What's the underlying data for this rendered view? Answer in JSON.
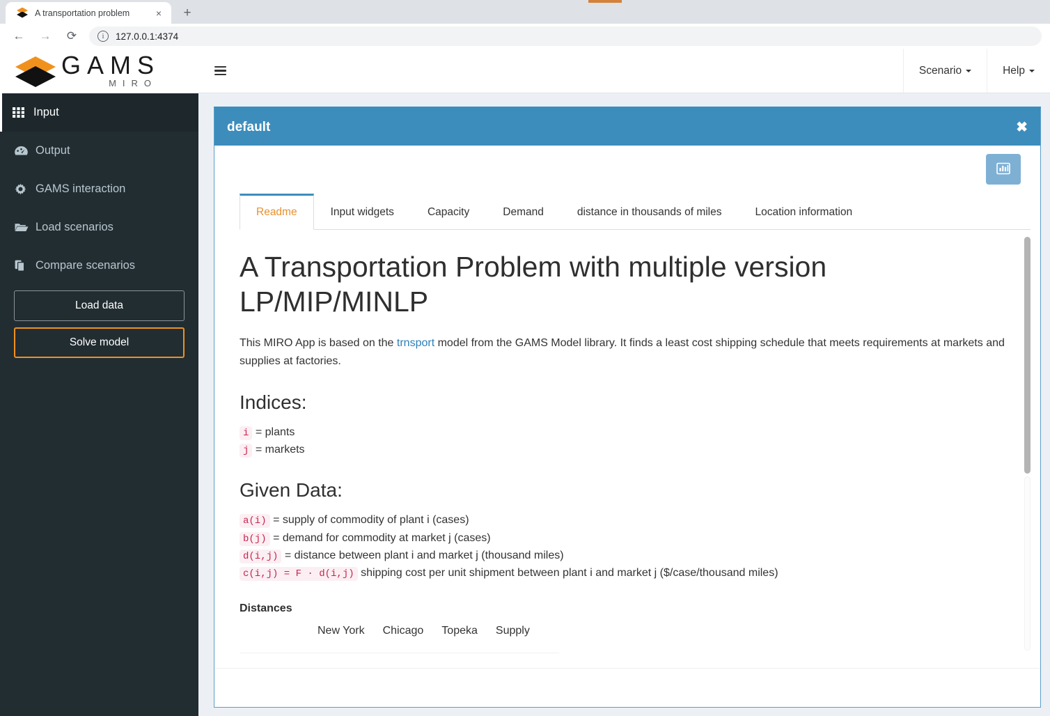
{
  "browser": {
    "tab_title": "A transportation problem",
    "tab_close_label": "×",
    "new_tab_label": "+",
    "back_label": "←",
    "forward_label": "→",
    "reload_label": "⟳",
    "site_info_label": "i",
    "url": "127.0.0.1:4374"
  },
  "brand": {
    "name": "GAMS",
    "sub": "MIRO",
    "orange": "#f0911e",
    "black": "#111111"
  },
  "sidebar": {
    "items": [
      {
        "label": "Input",
        "icon": "grid-icon",
        "active": true
      },
      {
        "label": "Output",
        "icon": "dashboard-icon",
        "active": false
      },
      {
        "label": "GAMS interaction",
        "icon": "gear-icon",
        "active": false
      },
      {
        "label": "Load scenarios",
        "icon": "folder-open-icon",
        "active": false
      },
      {
        "label": "Compare scenarios",
        "icon": "copy-icon",
        "active": false
      }
    ],
    "buttons": [
      {
        "label": "Load data",
        "style": "default"
      },
      {
        "label": "Solve model",
        "style": "accent"
      }
    ]
  },
  "topbar": {
    "menu_icon": "hamburger-icon",
    "scenario_label": "Scenario",
    "help_label": "Help"
  },
  "panel": {
    "title": "default",
    "close_label": "✖",
    "chart_button_icon": "bar-chart-icon",
    "accent_color": "#3c8dbc",
    "tabs": [
      {
        "label": "Readme",
        "active": true
      },
      {
        "label": "Input widgets",
        "active": false
      },
      {
        "label": "Capacity",
        "active": false
      },
      {
        "label": "Demand",
        "active": false
      },
      {
        "label": "distance in thousands of miles",
        "active": false
      },
      {
        "label": "Location information",
        "active": false
      }
    ]
  },
  "readme": {
    "title": "A Transportation Problem with multiple version LP/MIP/MINLP",
    "intro_before_link": "This MIRO App is based on the ",
    "intro_link": "trnsport",
    "intro_after_link": " model from the GAMS Model library. It finds a least cost shipping schedule that meets requirements at markets and supplies at factories.",
    "indices_heading": "Indices:",
    "indices": [
      {
        "code": "i",
        "text": "= plants"
      },
      {
        "code": "j",
        "text": "= markets"
      }
    ],
    "given_data_heading": "Given Data:",
    "given_data": [
      {
        "code": "a(i)",
        "text": "= supply of commodity of plant i (cases)"
      },
      {
        "code": "b(j)",
        "text": "= demand for commodity at market j (cases)"
      },
      {
        "code": "d(i,j)",
        "text": "= distance between plant i and market j (thousand miles)"
      },
      {
        "code": "c(i,j) = F · d(i,j)",
        "text": "shipping cost per unit shipment between plant i and market j ($/case/thousand miles)"
      }
    ],
    "distances_heading": "Distances",
    "distances_columns": [
      "New York",
      "Chicago",
      "Topeka",
      "Supply"
    ]
  }
}
